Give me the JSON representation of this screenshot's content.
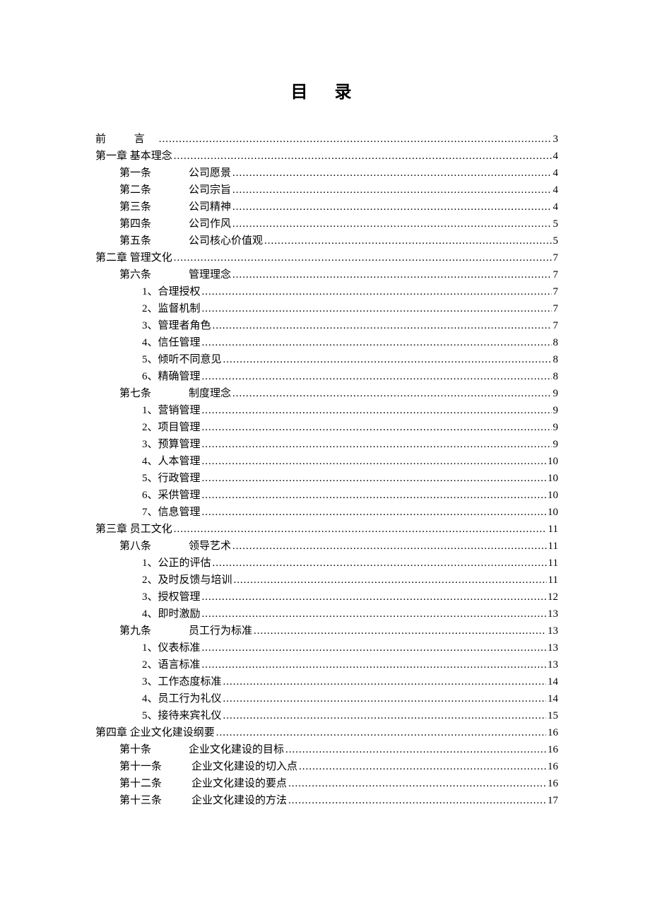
{
  "title": "目 录",
  "toc": [
    {
      "label": "前    言",
      "page": 3,
      "level": 0,
      "cls": "preface"
    },
    {
      "label": "第一章    基本理念",
      "page": 4,
      "level": 0
    },
    {
      "article": "第一条",
      "text": "公司愿景",
      "page": 4,
      "level": 1
    },
    {
      "article": "第二条",
      "text": "公司宗旨",
      "page": 4,
      "level": 1
    },
    {
      "article": "第三条",
      "text": "公司精神",
      "page": 4,
      "level": 1
    },
    {
      "article": "第四条",
      "text": "公司作风",
      "page": 5,
      "level": 1
    },
    {
      "article": "第五条",
      "text": "公司核心价值观",
      "page": 5,
      "level": 1
    },
    {
      "label": "第二章    管理文化",
      "page": 7,
      "level": 0
    },
    {
      "article": "第六条",
      "text": "管理理念",
      "page": 7,
      "level": 1
    },
    {
      "label": "1、合理授权",
      "page": 7,
      "level": 2
    },
    {
      "label": "2、监督机制",
      "page": 7,
      "level": 2
    },
    {
      "label": "3、管理者角色",
      "page": 7,
      "level": 2
    },
    {
      "label": "4、信任管理",
      "page": 8,
      "level": 2
    },
    {
      "label": "5、倾听不同意见",
      "page": 8,
      "level": 2
    },
    {
      "label": "6、精确管理",
      "page": 8,
      "level": 2
    },
    {
      "article": "第七条",
      "text": "制度理念",
      "page": 9,
      "level": 1
    },
    {
      "label": "1、营销管理",
      "page": 9,
      "level": 2
    },
    {
      "label": "2、项目管理",
      "page": 9,
      "level": 2
    },
    {
      "label": "3、预算管理",
      "page": 9,
      "level": 2
    },
    {
      "label": "4、人本管理",
      "page": 10,
      "level": 2
    },
    {
      "label": "5、行政管理",
      "page": 10,
      "level": 2
    },
    {
      "label": "6、采供管理",
      "page": 10,
      "level": 2
    },
    {
      "label": "7、信息管理",
      "page": 10,
      "level": 2
    },
    {
      "label": "第三章    员工文化",
      "page": 11,
      "level": 0
    },
    {
      "article": "第八条",
      "text": "领导艺术",
      "page": 11,
      "level": 1
    },
    {
      "label": "1、公正的评估",
      "page": 11,
      "level": 2
    },
    {
      "label": "2、及时反馈与培训",
      "page": 11,
      "level": 2
    },
    {
      "label": "3、授权管理",
      "page": 12,
      "level": 2
    },
    {
      "label": "4、即时激励",
      "page": 13,
      "level": 2
    },
    {
      "article": "第九条",
      "text": "员工行为标准",
      "page": 13,
      "level": 1
    },
    {
      "label": "1、仪表标准",
      "page": 13,
      "level": 2
    },
    {
      "label": "2、语言标准",
      "page": 13,
      "level": 2
    },
    {
      "label": "3、工作态度标准",
      "page": 14,
      "level": 2
    },
    {
      "label": "4、员工行为礼仪",
      "page": 14,
      "level": 2
    },
    {
      "label": "5、接待来宾礼仪",
      "page": 15,
      "level": 2
    },
    {
      "label": "第四章    企业文化建设纲要",
      "page": 16,
      "level": 0
    },
    {
      "article": "第十条",
      "text": "企业文化建设的目标",
      "page": 16,
      "level": 1
    },
    {
      "article": "第十一条",
      "text": "企业文化建设的切入点",
      "page": 16,
      "level": 1,
      "wide": true
    },
    {
      "article": "第十二条",
      "text": "企业文化建设的要点",
      "page": 16,
      "level": 1,
      "wide": true
    },
    {
      "article": "第十三条",
      "text": "企业文化建设的方法",
      "page": 17,
      "level": 1,
      "wide": true
    }
  ]
}
